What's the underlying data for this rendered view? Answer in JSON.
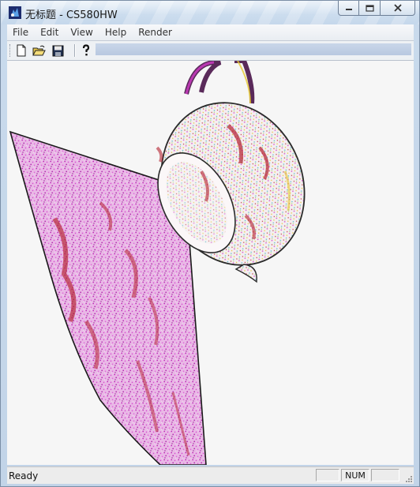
{
  "window": {
    "title": "无标题 - CS580HW",
    "app_icon": "app-icon"
  },
  "controls": {
    "minimize_icon": "minimize-icon",
    "maximize_icon": "maximize-icon",
    "close_icon": "close-icon"
  },
  "menubar": {
    "items": [
      "File",
      "Edit",
      "View",
      "Help",
      "Render"
    ]
  },
  "toolbar": {
    "buttons": [
      {
        "name": "new",
        "icon": "new-file-icon"
      },
      {
        "name": "open",
        "icon": "open-folder-icon"
      },
      {
        "name": "save",
        "icon": "save-disk-icon"
      },
      {
        "name": "help",
        "icon": "help-question-icon"
      }
    ]
  },
  "canvas": {
    "content": "rendered teapot and plane, non-photorealistic speckle texture"
  },
  "statusbar": {
    "status": "Ready",
    "indicators": [
      "",
      "NUM",
      ""
    ]
  },
  "colors": {
    "speckle_magenta": "#d23cc8",
    "speckle_red": "#b4202d",
    "teapot_yellow": "#e6c832",
    "background": "#f6f6f6"
  }
}
